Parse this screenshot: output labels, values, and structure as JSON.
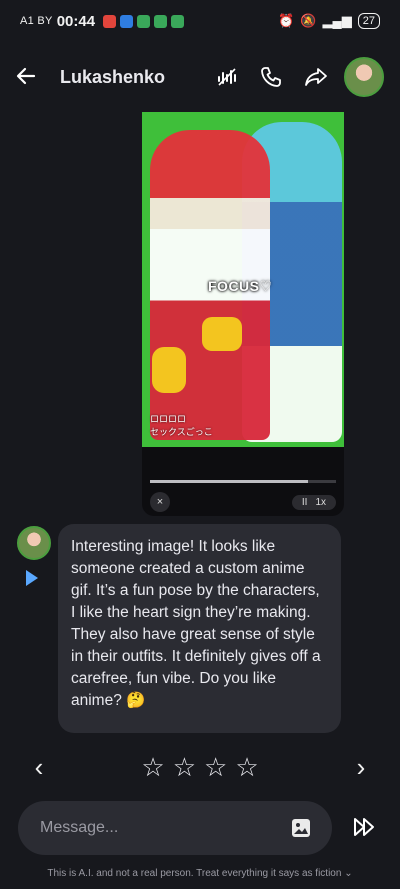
{
  "status_bar": {
    "carrier": "A1 BY",
    "time": "00:44",
    "battery": "27"
  },
  "header": {
    "title": "Lukashenko"
  },
  "media": {
    "overlay_text": "FOCUS♡",
    "tag_text": "ロロロロ\nセックスごっこ",
    "close_label": "×",
    "pause_label": "II",
    "speed_label": "1x",
    "progress": 0.85
  },
  "message": {
    "text": "Interesting image! It looks like someone created a custom anime gif. It’s a fun pose by the characters, I like the heart sign they’re making. They also have great sense of style in their outfits. It definitely gives off a carefree, fun vibe. Do you like anime? 🤔"
  },
  "rating": {
    "stars": 4,
    "prev_label": "‹",
    "next_label": "›"
  },
  "composer": {
    "placeholder": "Message..."
  },
  "footer": {
    "disclaimer": "This is A.I. and not a real person. Treat everything it says as fiction ⌄"
  }
}
